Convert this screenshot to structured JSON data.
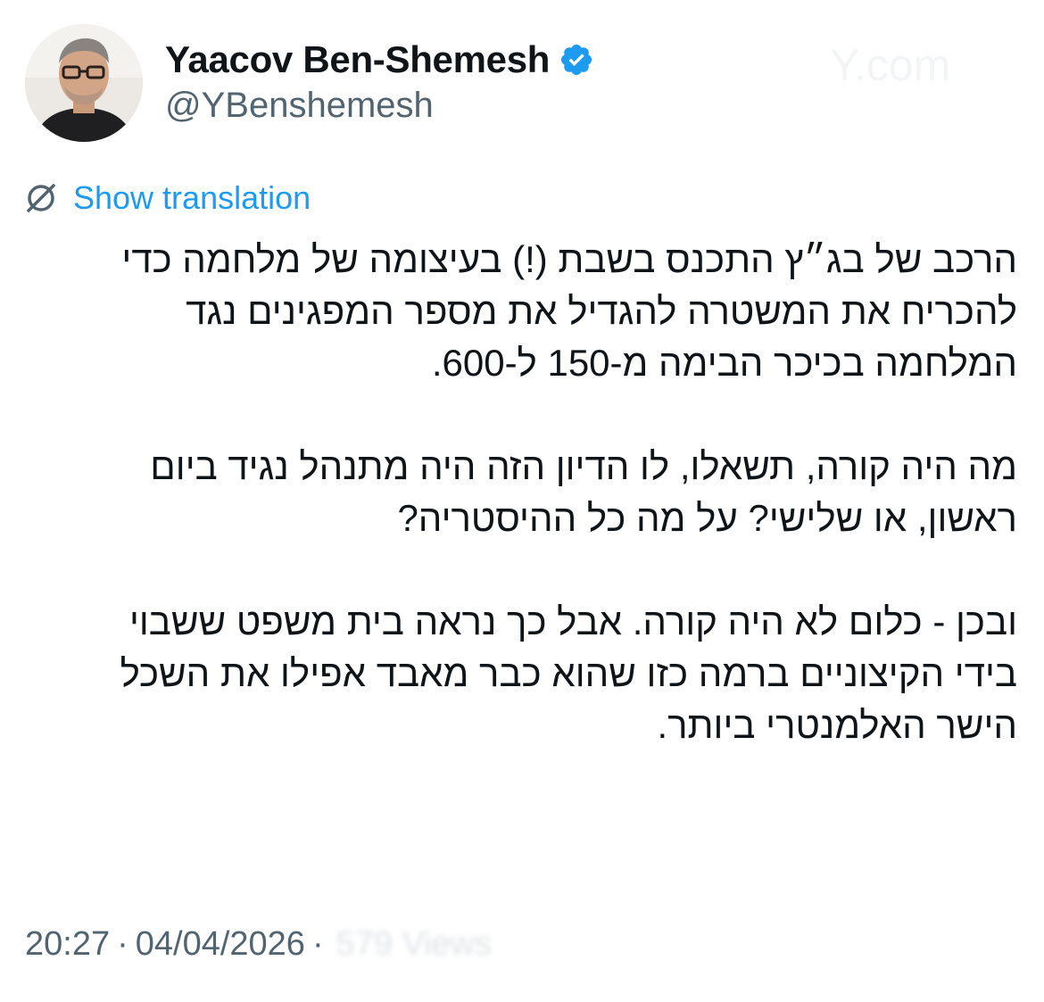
{
  "author": {
    "display_name": "Yaacov Ben-Shemesh",
    "handle": "@YBenshemesh",
    "verified": true,
    "avatar_icon": "profile-photo"
  },
  "translate": {
    "icon": "globe-translate-icon",
    "label": "Show translation"
  },
  "tweet": {
    "paragraphs": [
      [
        "הרכב של בג״ץ התכנס בשבת (!) בעיצומה של מלחמה כדי",
        "להכריח את המשטרה להגדיל את מספר המפגינים נגד",
        "המלחמה בכיכר הבימה מ-150 ל-600."
      ],
      [
        "מה היה קורה, תשאלו, לו הדיון הזה היה מתנהל נגיד ביום",
        "ראשון, או שלישי? על מה כל ההיסטריה?"
      ],
      [
        "ובכן - כלום לא היה קורה. אבל כך נראה בית משפט ששבוי",
        "בידי הקיצוניים ברמה כזו שהוא כבר מאבד אפילו את השכל",
        "הישר האלמנטרי ביותר."
      ]
    ]
  },
  "meta": {
    "time": "20:27",
    "separator": "·",
    "date": "04/04/2026",
    "views_obscured": "579 Views"
  },
  "colors": {
    "text": "#0f1419",
    "secondary": "#536471",
    "link": "#1d9bf0",
    "verified": "#1d9bf0"
  }
}
